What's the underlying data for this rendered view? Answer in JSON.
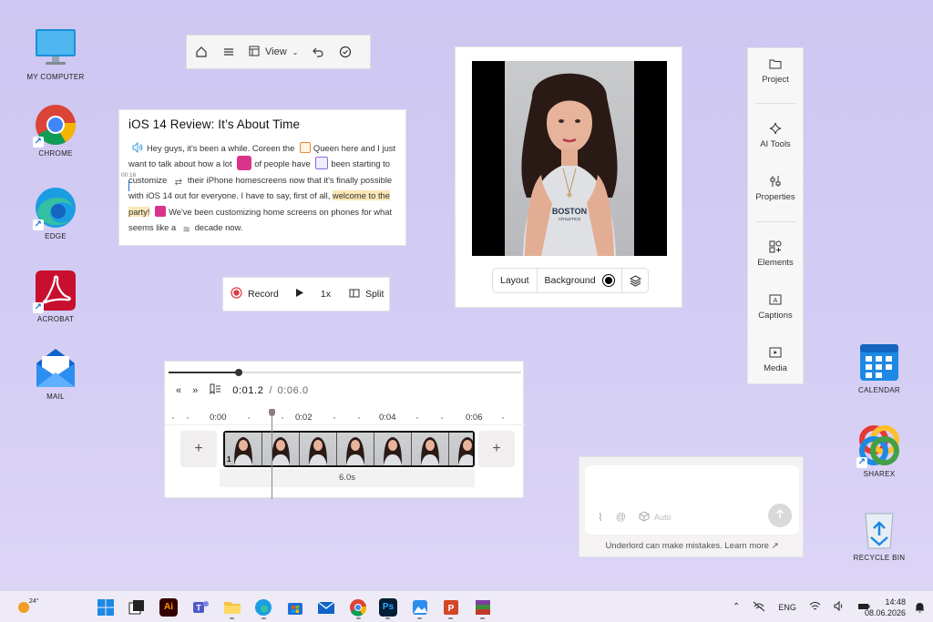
{
  "desktop": {
    "icons_left": [
      {
        "label": "MY COMPUTER"
      },
      {
        "label": "CHROME"
      },
      {
        "label": "EDGE"
      },
      {
        "label": "ACROBAT"
      },
      {
        "label": "MAIL"
      }
    ],
    "icons_right": [
      {
        "label": "CALENDAR"
      },
      {
        "label": "SHAREX"
      },
      {
        "label": "RECYCLE BIN"
      }
    ]
  },
  "toolbar": {
    "view_label": "View"
  },
  "transcript": {
    "title": "iOS 14 Review: It’s About Time",
    "timestamp": "00:16",
    "seg1": "Hey guys, it's been a while. Coreen the",
    "seg2": "Queen here and I just want to talk about how a lot",
    "seg3": "of people have",
    "seg4": "been starting to customize",
    "seg5": "their iPhone homescreens now that it's finally possible with iOS 14 out for everyone.",
    "seg6": "I have to say, first of all,",
    "highlight": "welcome to the party!",
    "seg7": "We've been customizing home screens on phones for what seems like a",
    "seg8": "decade now."
  },
  "recordbar": {
    "record_label": "Record",
    "speed_label": "1x",
    "split_label": "Split"
  },
  "preview": {
    "layout_label": "Layout",
    "background_label": "Background",
    "shirt_line1": "BOSTON",
    "shirt_line2": "ATHLETICS"
  },
  "sidepanel": {
    "items": [
      {
        "label": "Project",
        "icon": "folder-icon"
      },
      {
        "label": "AI Tools",
        "icon": "sparkle-icon"
      },
      {
        "label": "Properties",
        "icon": "sliders-icon"
      },
      {
        "label": "Elements",
        "icon": "shapes-icon"
      },
      {
        "label": "Captions",
        "icon": "captions-icon"
      },
      {
        "label": "Media",
        "icon": "media-icon"
      }
    ]
  },
  "timeline": {
    "current_time": "0:01.2",
    "separator": "/",
    "total_time": "0:06.0",
    "progress": 0.2,
    "ruler": [
      "0:00",
      "0:02",
      "0:04",
      "0:06"
    ],
    "clip_duration": "6.0s",
    "clip_index": "1"
  },
  "chat": {
    "placeholder": "",
    "auto_label": "Auto",
    "disclaimer": "Underlord can make mistakes. Learn more ↗"
  },
  "taskbar": {
    "weather": "24°",
    "language": "ENG",
    "time": "14:48",
    "date": "08.06.2026"
  },
  "colors": {
    "desktop_bg": "#cdc7f1",
    "accent_pink": "#d9338a",
    "record_red": "#e0393e",
    "highlight": "#fbe7b5"
  }
}
